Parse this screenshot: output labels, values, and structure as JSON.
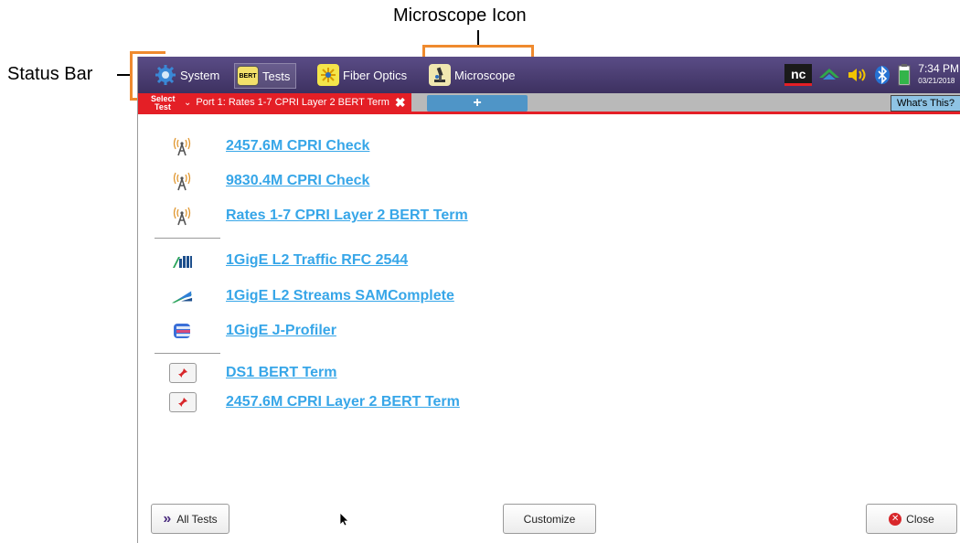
{
  "annotations": {
    "top": "Microscope Icon",
    "left": "Status Bar"
  },
  "status_bar": {
    "system": "System",
    "tests": "Tests",
    "tests_icon_text": "BERT",
    "fiber_optics": "Fiber Optics",
    "microscope": "Microscope",
    "nc_badge": "nc",
    "time": "7:34 PM",
    "date": "03/21/2018"
  },
  "tab_bar": {
    "select_label_1": "Select",
    "select_label_2": "Test",
    "port_tab": "Port 1: Rates 1-7 CPRI Layer 2 BERT Term",
    "add_tab": "+",
    "whats_this": "What's This?"
  },
  "tests": [
    {
      "label": "2457.6M CPRI Check",
      "icon": "antenna-icon"
    },
    {
      "label": "9830.4M CPRI Check",
      "icon": "antenna-icon"
    },
    {
      "label": "Rates 1-7 CPRI Layer 2 BERT Term",
      "icon": "antenna-icon"
    },
    {
      "label": "1GigE L2 Traffic RFC 2544",
      "icon": "bars-icon"
    },
    {
      "label": "1GigE L2 Streams SAMComplete",
      "icon": "streams-icon"
    },
    {
      "label": "1GigE J-Profiler",
      "icon": "profiler-icon"
    },
    {
      "label": "DS1 BERT Term",
      "icon": "pin-icon"
    },
    {
      "label": "2457.6M CPRI Layer 2 BERT Term",
      "icon": "pin-icon"
    }
  ],
  "footer": {
    "all_tests": "All Tests",
    "customize": "Customize",
    "close": "Close"
  },
  "colors": {
    "status_bar": "#4a3e74",
    "tab_red": "#e41f26",
    "link_blue": "#37a6e8",
    "bracket_orange": "#ef8a2e"
  }
}
